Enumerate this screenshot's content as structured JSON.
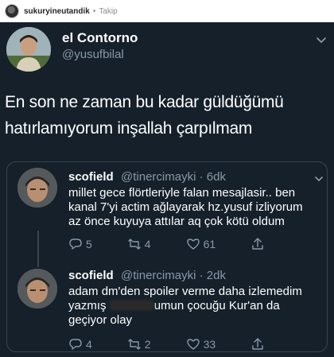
{
  "instagram": {
    "username": "sukuryineutandik",
    "separator": "•",
    "follow_label": "Takip"
  },
  "tweet": {
    "author_name": "el Contorno",
    "author_handle": "@yusufbilal",
    "text_line1": "En son ne zaman bu kadar güldüğümü",
    "text_line2": "hatırlamıyorum inşallah çarpılmam"
  },
  "replies": [
    {
      "name": "scofield",
      "handle": "@tinercimayki",
      "time": "· 6dk",
      "line1": "millet gece flörtleriyle falan mesajlasir.. ben",
      "line2": "kanal 7'yi actim ağlayarak hz.yusuf izliyorum",
      "line3": "az önce kuyuya attılar aq çok kötü oldum",
      "replies": "5",
      "retweets": "4",
      "likes": "61"
    },
    {
      "name": "scofield",
      "handle": "@tinercimayki",
      "time": "· 2dk",
      "line1": "adam dm'den spoiler verme daha izlemedim",
      "line2_before": "yazmış",
      "line2_after": "umun çocuğu Kur'an da",
      "line3": "geçiyor olay",
      "replies": "4",
      "retweets": "2",
      "likes": "33"
    }
  ],
  "colors": {
    "background": "#15202b",
    "secondary_text": "#8899a6",
    "border": "#38444d"
  },
  "icons": [
    "reply-icon",
    "retweet-icon",
    "like-icon",
    "share-icon",
    "chevron-down-icon"
  ]
}
